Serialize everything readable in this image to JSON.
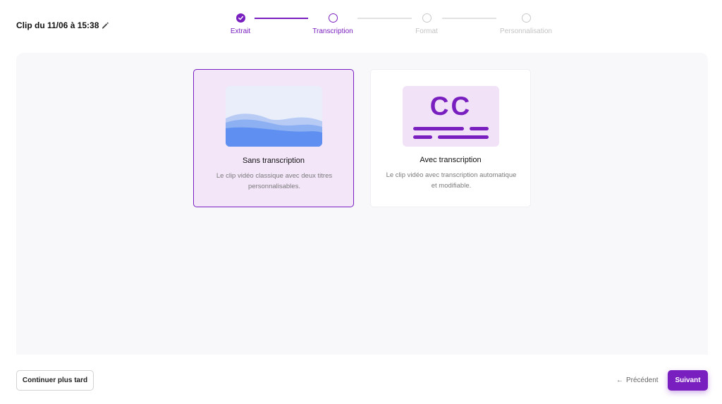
{
  "header": {
    "clip_title": "Clip du 11/06 à 15:38",
    "edit_icon": "pencil-icon"
  },
  "stepper": {
    "steps": [
      {
        "label": "Extrait",
        "state": "done"
      },
      {
        "label": "Transcription",
        "state": "current"
      },
      {
        "label": "Format",
        "state": "todo"
      },
      {
        "label": "Personnalisation",
        "state": "todo"
      }
    ]
  },
  "options": [
    {
      "title": "Sans transcription",
      "description": "Le clip vidéo classique avec deux titres personnalisables.",
      "selected": true,
      "icon": "waves-image-icon"
    },
    {
      "title": "Avec transcription",
      "description": "Le clip vidéo avec transcription automatique et modifiable.",
      "selected": false,
      "icon": "closed-captions-icon",
      "cc_text": "CC"
    }
  ],
  "footer": {
    "later_label": "Continuer plus tard",
    "prev_label": "Précédent",
    "next_label": "Suivant"
  },
  "colors": {
    "accent": "#7a1fbf",
    "selected_bg": "#f3e6f9",
    "panel_bg": "#f8f7fa"
  }
}
